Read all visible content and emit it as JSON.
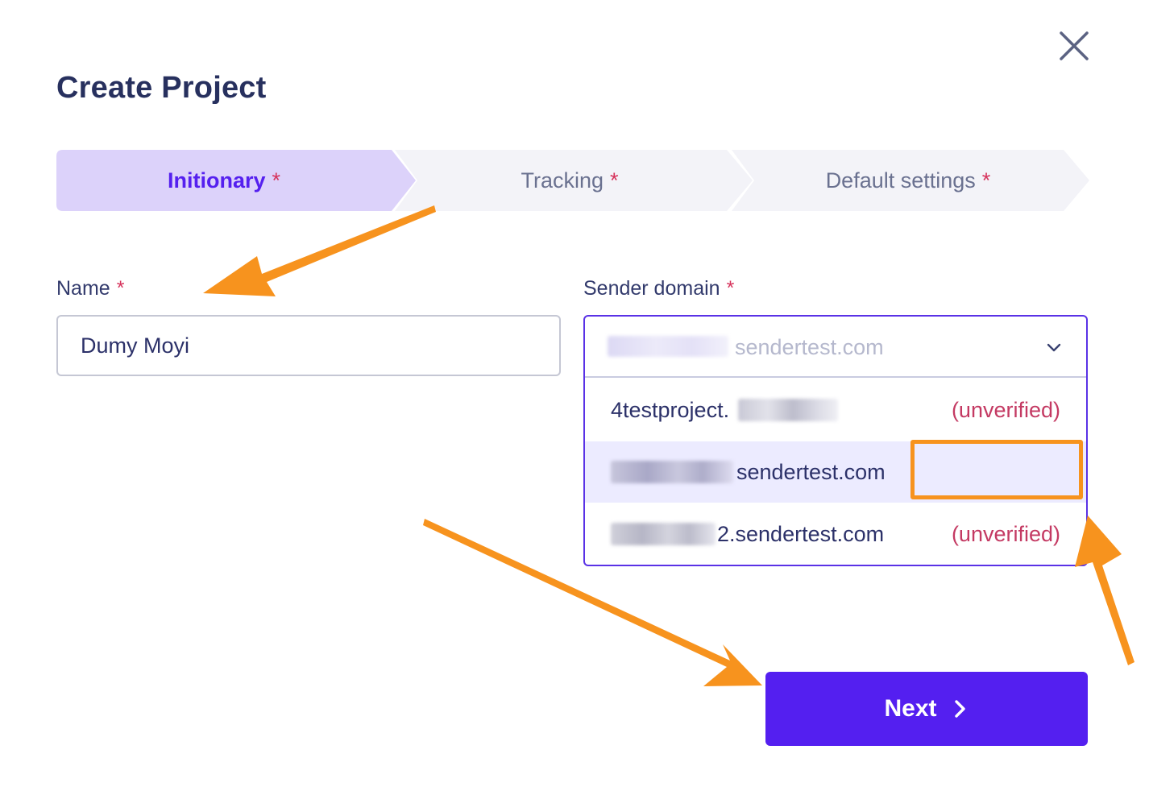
{
  "dialog": {
    "title": "Create Project",
    "close_icon": "close-icon"
  },
  "stepper": {
    "steps": [
      {
        "label": "Initionary",
        "required_mark": "*",
        "active": true
      },
      {
        "label": "Tracking",
        "required_mark": "*",
        "active": false
      },
      {
        "label": "Default settings",
        "required_mark": "*",
        "active": false
      }
    ]
  },
  "form": {
    "name": {
      "label": "Name",
      "required_mark": "*",
      "value": "Dumy Moyi"
    },
    "sender_domain": {
      "label": "Sender domain",
      "required_mark": "*",
      "selected_value": "sendertest.com",
      "options": [
        {
          "text": "4testproject.",
          "status": "(unverified)"
        },
        {
          "text": "sendertest.com",
          "status": ""
        },
        {
          "text": "2.sendertest.com",
          "status": "(unverified)"
        }
      ]
    }
  },
  "actions": {
    "next_label": "Next"
  },
  "colors": {
    "accent": "#541ff0",
    "active_step_bg": "#dcd2fa",
    "inactive_step_bg": "#f3f3f8",
    "required": "#d6335c",
    "unverified": "#c43a63",
    "annotation": "#f7931e"
  },
  "icons": [
    "close-icon",
    "chevron-down-icon",
    "chevron-right-icon"
  ]
}
